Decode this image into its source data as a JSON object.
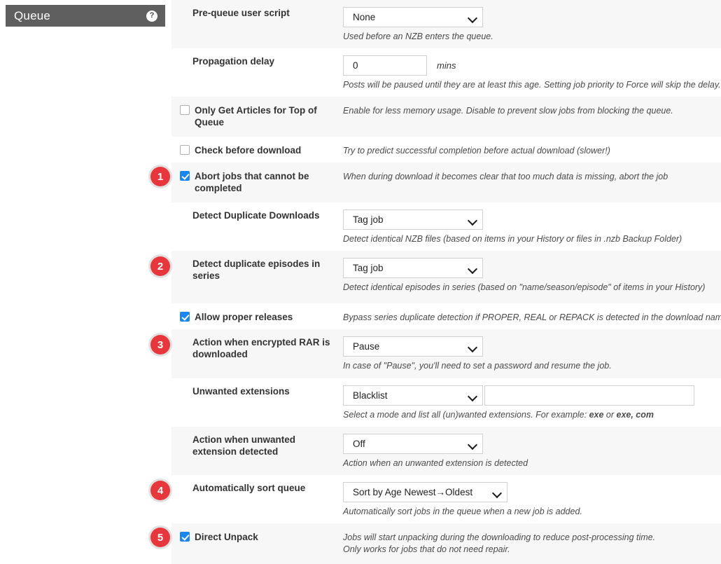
{
  "panel": {
    "title": "Queue",
    "help_icon": "question-mark-icon"
  },
  "rows": [
    {
      "id": "pre-queue-user-script",
      "label": "Pre-queue user script",
      "type": "select",
      "value": "None",
      "hint": "Used before an NZB enters the queue.",
      "badge": null
    },
    {
      "id": "propagation-delay",
      "label": "Propagation delay",
      "type": "number",
      "value": "0",
      "unit": "mins",
      "hint": "Posts will be paused until they are at least this age. Setting job priority to Force will skip the delay.",
      "badge": null
    },
    {
      "id": "only-get-articles-for-top-of-queue",
      "label": "Only Get Articles for Top of Queue",
      "type": "checkbox",
      "checked": false,
      "hint": "Enable for less memory usage. Disable to prevent slow jobs from blocking the queue.",
      "badge": null
    },
    {
      "id": "check-before-download",
      "label": "Check before download",
      "type": "checkbox",
      "checked": false,
      "hint": "Try to predict successful completion before actual download (slower!)",
      "badge": null
    },
    {
      "id": "abort-jobs-that-cannot-be-completed",
      "label": "Abort jobs that cannot be completed",
      "type": "checkbox",
      "checked": true,
      "hint": "When during download it becomes clear that too much data is missing, abort the job",
      "badge": "1"
    },
    {
      "id": "detect-duplicate-downloads",
      "label": "Detect Duplicate Downloads",
      "type": "select",
      "value": "Tag job",
      "hint": "Detect identical NZB files (based on items in your History or files in .nzb Backup Folder)",
      "badge": null
    },
    {
      "id": "detect-duplicate-episodes-in-series",
      "label": "Detect duplicate episodes in series",
      "type": "select",
      "value": "Tag job",
      "hint": "Detect identical episodes in series (based on \"name/season/episode\" of items in your History)",
      "badge": "2"
    },
    {
      "id": "allow-proper-releases",
      "label": "Allow proper releases",
      "type": "checkbox",
      "checked": true,
      "hint": "Bypass series duplicate detection if PROPER, REAL or REPACK is detected in the download name",
      "badge": null
    },
    {
      "id": "action-when-encrypted-rar-is-downloaded",
      "label": "Action when encrypted RAR is downloaded",
      "type": "select",
      "value": "Pause",
      "hint": "In case of \"Pause\", you'll need to set a password and resume the job.",
      "badge": "3"
    },
    {
      "id": "unwanted-extensions",
      "label": "Unwanted extensions",
      "type": "select-plus-text",
      "value": "Blacklist",
      "text_value": "",
      "hint_parts": [
        {
          "text": "Select a mode and list all (un)wanted extensions. For example: ",
          "bold": false
        },
        {
          "text": "exe",
          "bold": true
        },
        {
          "text": " or ",
          "bold": false
        },
        {
          "text": "exe, com",
          "bold": true
        }
      ],
      "badge": null
    },
    {
      "id": "action-when-unwanted-extension-detected",
      "label": "Action when unwanted extension detected",
      "type": "select",
      "value": "Off",
      "hint": "Action when an unwanted extension is detected",
      "badge": null
    },
    {
      "id": "automatically-sort-queue",
      "label": "Automatically sort queue",
      "type": "select",
      "value": "Sort by Age Newest→Oldest",
      "hint": "Automatically sort jobs in the queue when a new job is added.",
      "badge": "4"
    },
    {
      "id": "direct-unpack",
      "label": "Direct Unpack",
      "type": "checkbox",
      "checked": true,
      "hint": "Jobs will start unpacking during the downloading to reduce post-processing time.",
      "hint2": "Only works for jobs that do not need repair.",
      "badge": "5"
    }
  ],
  "colors": {
    "header_bg": "#5f5f5f",
    "badge_bg": "#e8373c",
    "checkbox_checked": "#1a86ef",
    "row_alt_bg": "#f7f7f7"
  }
}
